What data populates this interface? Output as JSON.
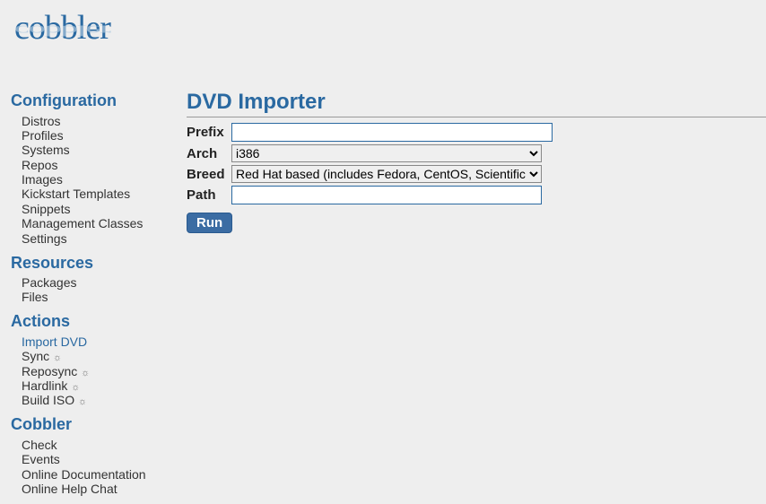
{
  "logo": "cobbler",
  "sidebar": {
    "sections": [
      {
        "heading": "Configuration",
        "items": [
          {
            "label": "Distros"
          },
          {
            "label": "Profiles"
          },
          {
            "label": "Systems"
          },
          {
            "label": "Repos"
          },
          {
            "label": "Images"
          },
          {
            "label": "Kickstart Templates"
          },
          {
            "label": "Snippets"
          },
          {
            "label": "Management Classes"
          },
          {
            "label": "Settings"
          }
        ]
      },
      {
        "heading": "Resources",
        "items": [
          {
            "label": "Packages"
          },
          {
            "label": "Files"
          }
        ]
      },
      {
        "heading": "Actions",
        "items": [
          {
            "label": "Import DVD",
            "active": true
          },
          {
            "label": "Sync",
            "gear": true
          },
          {
            "label": "Reposync",
            "gear": true
          },
          {
            "label": "Hardlink",
            "gear": true
          },
          {
            "label": "Build ISO",
            "gear": true
          }
        ]
      },
      {
        "heading": "Cobbler",
        "items": [
          {
            "label": "Check"
          },
          {
            "label": "Events"
          },
          {
            "label": "Online Documentation"
          },
          {
            "label": "Online Help Chat"
          }
        ]
      }
    ]
  },
  "main": {
    "title": "DVD Importer",
    "form": {
      "prefix": {
        "label": "Prefix",
        "value": ""
      },
      "arch": {
        "label": "Arch",
        "selected": "i386"
      },
      "breed": {
        "label": "Breed",
        "selected": "Red Hat based (includes Fedora, CentOS, Scientific Linux)"
      },
      "path": {
        "label": "Path",
        "value": ""
      },
      "run": "Run"
    }
  }
}
